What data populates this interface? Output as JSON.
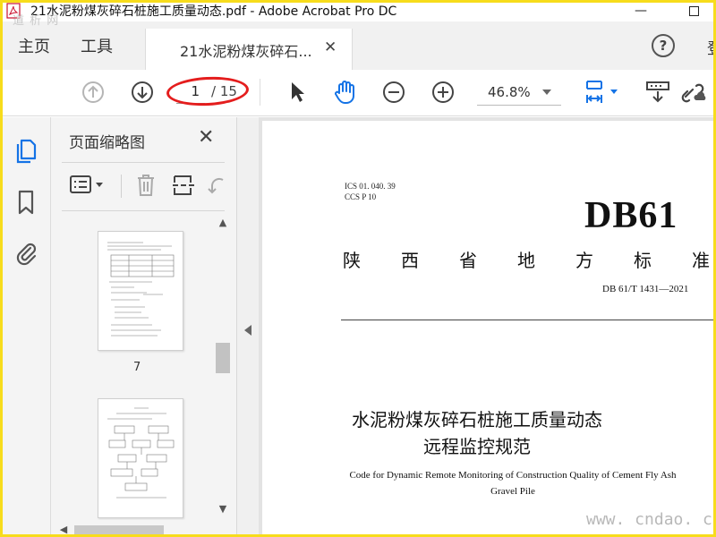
{
  "window": {
    "title": "21水泥粉煤灰碎石桩施工质量动态.pdf - Adobe Acrobat Pro DC",
    "minimize_glyph": "—",
    "watermark": "道 析 网"
  },
  "tabs": {
    "home": "主页",
    "tools": "工具",
    "document": "21水泥粉煤灰碎石...",
    "close_glyph": "✕",
    "help_glyph": "?",
    "signin_fragment": "登"
  },
  "toolbar": {
    "current_page": "1",
    "page_total": "/ 15",
    "zoom": "46.8%"
  },
  "thumbnails_panel": {
    "title": "页面缩略图",
    "close_glyph": "✕",
    "pages": [
      {
        "label": "7"
      },
      {
        "label": ""
      }
    ]
  },
  "document": {
    "ics": "ICS  01. 040. 39",
    "ccs": "CCS P  10",
    "standard": "DB61",
    "issuer_chars": [
      "陕",
      "西",
      "省",
      "地",
      "方",
      "标",
      "准"
    ],
    "number": "DB 61/T  1431—2021",
    "title_line1": "水泥粉煤灰碎石桩施工质量动态",
    "title_line2": "远程监控规范",
    "title_en_line1": "Code for Dynamic Remote Monitoring of Construction Quality of Cement Fly Ash",
    "title_en_line2": "Gravel Pile"
  },
  "site_watermark": "www. cndao. com",
  "colors": {
    "frame": "#f7dc1c",
    "accent_blue": "#1473e6",
    "highlight_red": "#e41d1d"
  },
  "icons": {
    "app": "acrobat-icon",
    "prev_page": "arrow-up-circle-icon",
    "next_page": "arrow-down-circle-icon",
    "select": "cursor-arrow-icon",
    "hand": "hand-icon",
    "zoom_out": "minus-circle-icon",
    "zoom_in": "plus-circle-icon",
    "fit": "fit-page-icon",
    "scroll_mode": "scroll-mode-icon",
    "link": "link-cloud-icon",
    "thumbnails": "page-thumbnails-icon",
    "bookmarks": "bookmark-icon",
    "attachments": "paperclip-icon"
  }
}
